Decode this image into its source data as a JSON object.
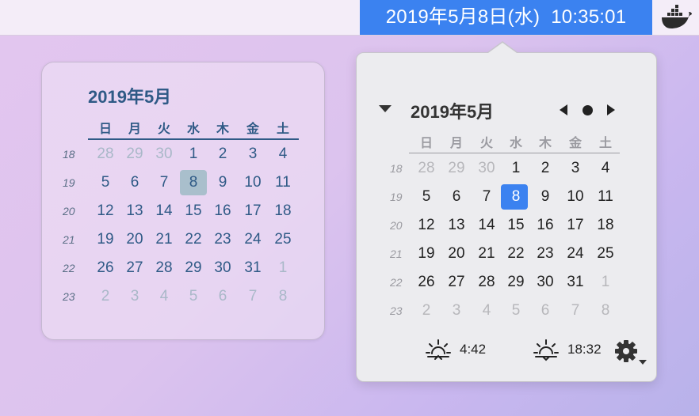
{
  "menubar": {
    "date": "2019年5月8日(水)",
    "time": "10:35:01",
    "icon": "docker-whale-icon",
    "accent": "#3b82f0"
  },
  "widget": {
    "title": "2019年5月",
    "weekdays": [
      "日",
      "月",
      "火",
      "水",
      "木",
      "金",
      "土"
    ],
    "weeks": [
      {
        "wk": "18",
        "days": [
          {
            "d": "28",
            "dim": true
          },
          {
            "d": "29",
            "dim": true
          },
          {
            "d": "30",
            "dim": true
          },
          {
            "d": "1"
          },
          {
            "d": "2"
          },
          {
            "d": "3"
          },
          {
            "d": "4"
          }
        ]
      },
      {
        "wk": "19",
        "days": [
          {
            "d": "5"
          },
          {
            "d": "6"
          },
          {
            "d": "7"
          },
          {
            "d": "8",
            "today": true
          },
          {
            "d": "9"
          },
          {
            "d": "10"
          },
          {
            "d": "11"
          }
        ]
      },
      {
        "wk": "20",
        "days": [
          {
            "d": "12"
          },
          {
            "d": "13"
          },
          {
            "d": "14"
          },
          {
            "d": "15"
          },
          {
            "d": "16"
          },
          {
            "d": "17"
          },
          {
            "d": "18"
          }
        ]
      },
      {
        "wk": "21",
        "days": [
          {
            "d": "19"
          },
          {
            "d": "20"
          },
          {
            "d": "21"
          },
          {
            "d": "22"
          },
          {
            "d": "23"
          },
          {
            "d": "24"
          },
          {
            "d": "25"
          }
        ]
      },
      {
        "wk": "22",
        "days": [
          {
            "d": "26"
          },
          {
            "d": "27"
          },
          {
            "d": "28"
          },
          {
            "d": "29"
          },
          {
            "d": "30"
          },
          {
            "d": "31"
          },
          {
            "d": "1",
            "dim": true
          }
        ]
      },
      {
        "wk": "23",
        "days": [
          {
            "d": "2",
            "dim": true
          },
          {
            "d": "3",
            "dim": true
          },
          {
            "d": "4",
            "dim": true
          },
          {
            "d": "5",
            "dim": true
          },
          {
            "d": "6",
            "dim": true
          },
          {
            "d": "7",
            "dim": true
          },
          {
            "d": "8",
            "dim": true
          }
        ]
      }
    ]
  },
  "popover": {
    "title": "2019年5月",
    "weekdays": [
      "日",
      "月",
      "火",
      "水",
      "木",
      "金",
      "土"
    ],
    "weeks": [
      {
        "wk": "18",
        "days": [
          {
            "d": "28",
            "dim": true
          },
          {
            "d": "29",
            "dim": true
          },
          {
            "d": "30",
            "dim": true
          },
          {
            "d": "1"
          },
          {
            "d": "2"
          },
          {
            "d": "3"
          },
          {
            "d": "4"
          }
        ]
      },
      {
        "wk": "19",
        "days": [
          {
            "d": "5"
          },
          {
            "d": "6"
          },
          {
            "d": "7"
          },
          {
            "d": "8",
            "today": true
          },
          {
            "d": "9"
          },
          {
            "d": "10"
          },
          {
            "d": "11"
          }
        ]
      },
      {
        "wk": "20",
        "days": [
          {
            "d": "12"
          },
          {
            "d": "13"
          },
          {
            "d": "14"
          },
          {
            "d": "15"
          },
          {
            "d": "16"
          },
          {
            "d": "17"
          },
          {
            "d": "18"
          }
        ]
      },
      {
        "wk": "21",
        "days": [
          {
            "d": "19"
          },
          {
            "d": "20"
          },
          {
            "d": "21"
          },
          {
            "d": "22"
          },
          {
            "d": "23"
          },
          {
            "d": "24"
          },
          {
            "d": "25"
          }
        ]
      },
      {
        "wk": "22",
        "days": [
          {
            "d": "26"
          },
          {
            "d": "27"
          },
          {
            "d": "28"
          },
          {
            "d": "29"
          },
          {
            "d": "30"
          },
          {
            "d": "31"
          },
          {
            "d": "1",
            "dim": true
          }
        ]
      },
      {
        "wk": "23",
        "days": [
          {
            "d": "2",
            "dim": true
          },
          {
            "d": "3",
            "dim": true
          },
          {
            "d": "4",
            "dim": true
          },
          {
            "d": "5",
            "dim": true
          },
          {
            "d": "6",
            "dim": true
          },
          {
            "d": "7",
            "dim": true
          },
          {
            "d": "8",
            "dim": true
          }
        ]
      }
    ],
    "sunrise": "4:42",
    "sunset": "18:32",
    "icons": [
      "disclosure-triangle-icon",
      "previous-month-icon",
      "today-dot-icon",
      "next-month-icon",
      "sunrise-icon",
      "sunset-icon",
      "gear-icon"
    ]
  }
}
